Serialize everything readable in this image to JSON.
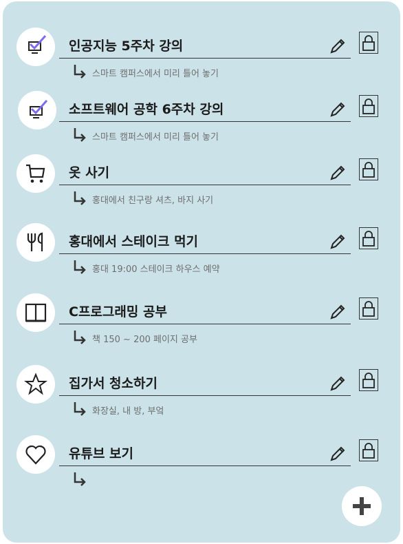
{
  "items": [
    {
      "title": "인공지능 5주차 강의",
      "sub": "스마트 캠퍼스에서 미리 틀어 놓기",
      "icon": "checked-monitor-icon"
    },
    {
      "title": "소프트웨어 공학 6주차 강의",
      "sub": "스마트 캠퍼스에서 미리 틀어 놓기",
      "icon": "checked-monitor-icon"
    },
    {
      "title": "옷 사기",
      "sub": "홍대에서 친구랑 셔츠, 바지 사기",
      "icon": "cart-icon"
    },
    {
      "title": "홍대에서 스테이크 먹기",
      "sub": "홍대 19:00 스테이크 하우스 예약",
      "icon": "fork-knife-icon"
    },
    {
      "title": "C프로그래밍 공부",
      "sub": "책 150 ~ 200 페이지 공부",
      "icon": "book-icon"
    },
    {
      "title": "집가서 청소하기",
      "sub": "화장실, 내 방, 부엌",
      "icon": "star-icon"
    },
    {
      "title": "유튜브 보기",
      "sub": "",
      "icon": "heart-icon"
    }
  ],
  "colors": {
    "panel": "#cbe2e8",
    "check": "#7b6cf0",
    "text": "#1b1b1b",
    "subtext": "#6e6e6e"
  }
}
